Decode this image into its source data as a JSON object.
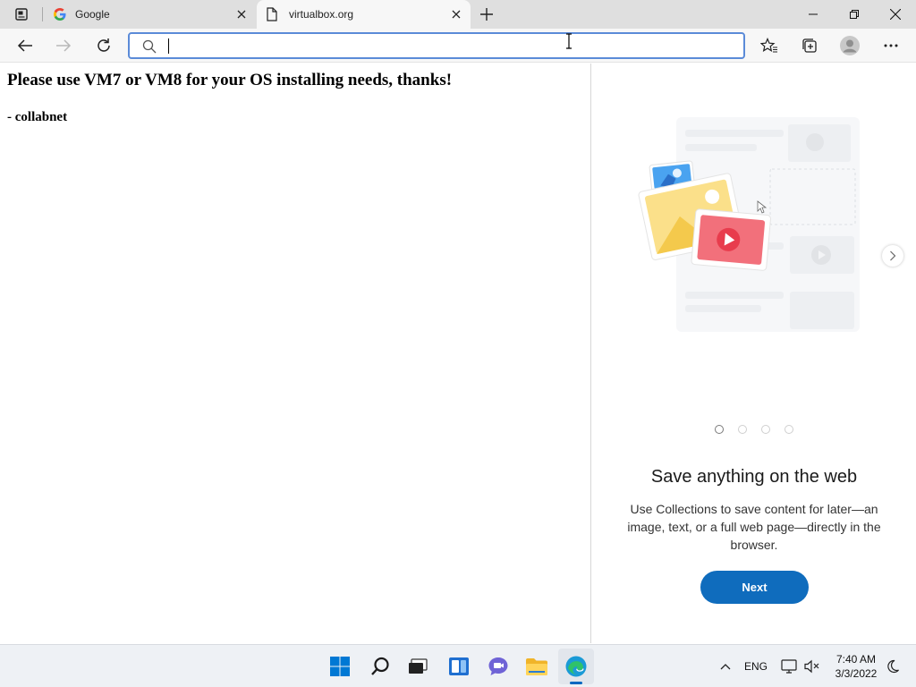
{
  "browser": {
    "tabs": [
      {
        "title": "Google",
        "active": false,
        "favicon": "google-g-icon"
      },
      {
        "title": "virtualbox.org",
        "active": true,
        "favicon": "page-icon"
      }
    ],
    "omnibox": {
      "value": "",
      "placeholder": ""
    }
  },
  "page": {
    "heading": "Please use VM7 or VM8 for your OS installing needs, thanks!",
    "signature": "- collabnet"
  },
  "collections_panel": {
    "title": "Save anything on the web",
    "description": "Use Collections to save content for later—an image, text, or a full web page—directly in the browser.",
    "next_label": "Next",
    "slide_count": 4,
    "current_slide": 1
  },
  "taskbar": {
    "lang": "ENG",
    "time": "7:40 AM",
    "date": "3/3/2022"
  },
  "colors": {
    "accent": "#0f6cbd",
    "omnibox_focus": "#5b8bd8",
    "tabstrip": "#dfdfdf",
    "toolbar": "#f7f7f7"
  }
}
